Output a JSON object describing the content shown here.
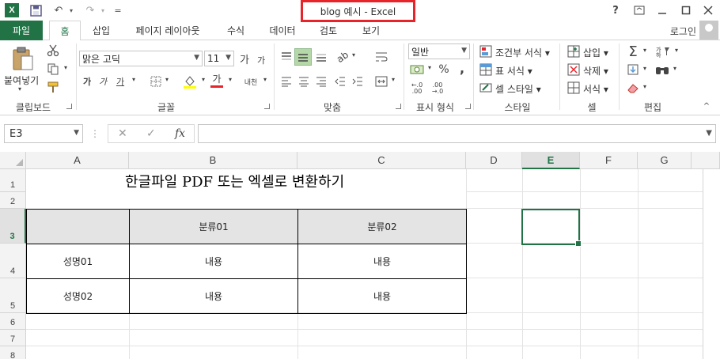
{
  "window": {
    "title": "blog 예시 - Excel",
    "help": "?",
    "ribbon_display": "⧉",
    "minimize": "—",
    "maximize": "☐",
    "close": "✕"
  },
  "quick_access": {
    "logo": "X",
    "save_icon": "save-icon",
    "undo": "↶",
    "redo": "↷",
    "customize": "="
  },
  "tabs": [
    "파일",
    "홈",
    "삽입",
    "페이지 레이아웃",
    "수식",
    "데이터",
    "검토",
    "보기"
  ],
  "account": {
    "login": "로그인"
  },
  "ribbon": {
    "clipboard": {
      "paste": "붙여넣기",
      "label": "클립보드"
    },
    "font": {
      "name": "맑은 고딕",
      "size": "11",
      "grow": "가",
      "shrink": "가",
      "bold": "가",
      "italic": "가",
      "underline": "가",
      "font_color": "가",
      "phonetic": "내천",
      "label": "글꼴"
    },
    "alignment": {
      "label": "맞춤"
    },
    "number": {
      "format": "일반",
      "percent": "%",
      "comma": ",",
      "label": "표시 형식"
    },
    "styles": {
      "conditional": "조건부 서식",
      "table": "표 서식",
      "cell_styles": "셀 스타일",
      "label": "스타일"
    },
    "cells": {
      "insert": "삽입",
      "delete": "삭제",
      "format": "서식",
      "label": "셀"
    },
    "editing": {
      "sum": "Σ",
      "label": "편집"
    }
  },
  "formula_bar": {
    "name_box": "E3",
    "cancel": "✕",
    "enter": "✓",
    "fx": "fx",
    "value": ""
  },
  "sheet": {
    "columns": [
      "A",
      "B",
      "C",
      "D",
      "E",
      "F",
      "G"
    ],
    "rows": [
      "1",
      "2",
      "3",
      "4",
      "5",
      "6",
      "7",
      "8"
    ],
    "selected_column": "E",
    "selected_row": "3",
    "title": "한글파일 PDF 또는 엑셀로 변환하기",
    "table": {
      "header": [
        "",
        "분류01",
        "분류02"
      ],
      "rows": [
        [
          "성명01",
          "내용",
          "내용"
        ],
        [
          "성명02",
          "내용",
          "내용"
        ]
      ]
    }
  },
  "colors": {
    "excel_green": "#217346",
    "highlight_box": "#e8242b",
    "header_fill": "#e4e4e4"
  }
}
